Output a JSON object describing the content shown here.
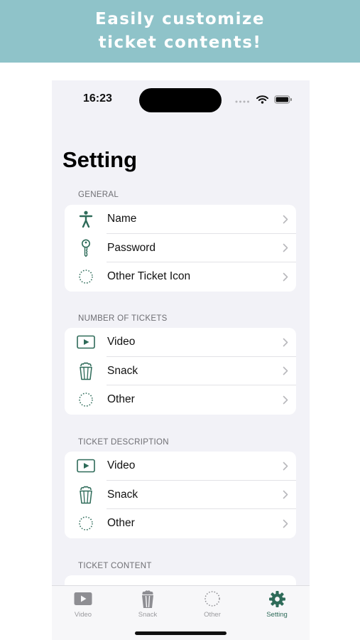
{
  "banner": {
    "line1": "Easily customize",
    "line2": "ticket contents!"
  },
  "status": {
    "time": "16:23",
    "icons": [
      "cellular-dots-icon",
      "wifi-icon",
      "battery-icon"
    ]
  },
  "title": "Setting",
  "colors": {
    "accent": "#2e6b59",
    "banner": "#8fc3c9",
    "background": "#f2f2f7"
  },
  "sections": [
    {
      "header": "GENERAL",
      "items": [
        {
          "label": "Name",
          "icon": "person-icon"
        },
        {
          "label": "Password",
          "icon": "key-icon"
        },
        {
          "label": "Other Ticket Icon",
          "icon": "dotted-circle-icon"
        }
      ]
    },
    {
      "header": "NUMBER OF TICKETS",
      "items": [
        {
          "label": "Video",
          "icon": "play-icon"
        },
        {
          "label": "Snack",
          "icon": "popcorn-icon"
        },
        {
          "label": "Other",
          "icon": "dotted-circle-icon"
        }
      ]
    },
    {
      "header": "TICKET DESCRIPTION",
      "items": [
        {
          "label": "Video",
          "icon": "play-icon"
        },
        {
          "label": "Snack",
          "icon": "popcorn-icon"
        },
        {
          "label": "Other",
          "icon": "dotted-circle-icon"
        }
      ]
    },
    {
      "header": "TICKET CONTENT",
      "items": []
    }
  ],
  "tabs": [
    {
      "label": "Video",
      "icon": "play-icon",
      "active": false
    },
    {
      "label": "Snack",
      "icon": "popcorn-icon",
      "active": false
    },
    {
      "label": "Other",
      "icon": "dotted-circle-icon",
      "active": false
    },
    {
      "label": "Setting",
      "icon": "gear-icon",
      "active": true
    }
  ]
}
